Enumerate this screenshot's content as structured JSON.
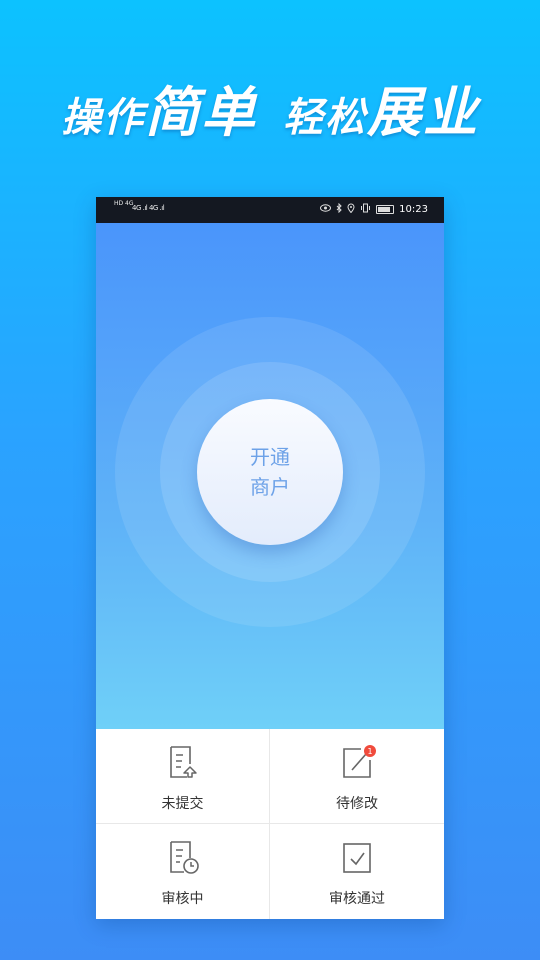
{
  "headline": {
    "part1": "操作",
    "part2": "简单",
    "part3": "轻松",
    "part4": "展业"
  },
  "status_bar": {
    "left_badges": "HD 4G",
    "signal_text": "4G .ıl 4G .ıl",
    "time": "10:23",
    "icons": [
      "eye-icon",
      "bluetooth-icon",
      "location-icon",
      "vibrate-icon",
      "battery-icon"
    ]
  },
  "hero": {
    "button_line1": "开通",
    "button_line2": "商户"
  },
  "menu": {
    "items": [
      {
        "label": "未提交",
        "icon": "document-upload-icon"
      },
      {
        "label": "待修改",
        "icon": "edit-icon",
        "badge": "1"
      },
      {
        "label": "审核中",
        "icon": "document-clock-icon"
      },
      {
        "label": "审核通过",
        "icon": "approved-check-icon"
      }
    ]
  },
  "colors": {
    "background_top": "#0cc2ff",
    "background_bottom": "#3d8df6",
    "hero_top": "#4a95fb",
    "hero_bottom": "#6fd0f8",
    "button_text": "#6da2e8",
    "badge": "#f04b3c",
    "icon_stroke": "#666666"
  }
}
